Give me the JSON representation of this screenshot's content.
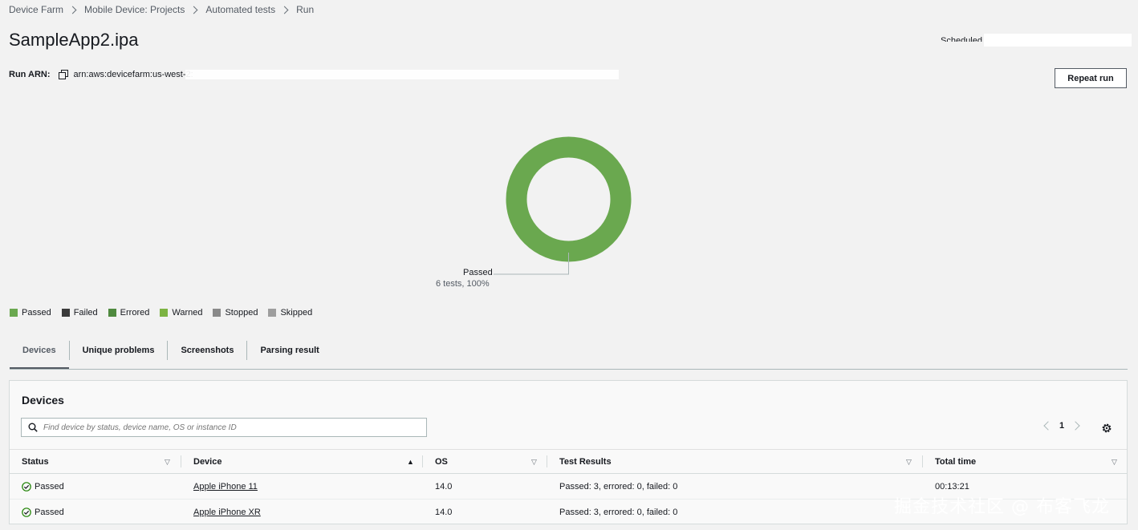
{
  "breadcrumb": [
    "Device Farm",
    "Mobile Device: Projects",
    "Automated tests",
    "Run"
  ],
  "title": "SampleApp2.ipa",
  "status_label": "Scheduled",
  "run_arn": {
    "label": "Run ARN:",
    "value": "arn:aws:devicefarm:us-west-2:"
  },
  "actions": {
    "repeat_run": "Repeat run"
  },
  "donut": {
    "label": "Passed",
    "detail": "6 tests, 100%",
    "passed_fraction": 1.0,
    "color": "#6aa84f"
  },
  "legend": [
    {
      "name": "Passed",
      "color": "#6aa84f"
    },
    {
      "name": "Failed",
      "color": "#3b3b3b"
    },
    {
      "name": "Errored",
      "color": "#4f8a3f"
    },
    {
      "name": "Warned",
      "color": "#7cb342"
    },
    {
      "name": "Stopped",
      "color": "#8a8a8a"
    },
    {
      "name": "Skipped",
      "color": "#9e9e9e"
    }
  ],
  "tabs": [
    "Devices",
    "Unique problems",
    "Screenshots",
    "Parsing result"
  ],
  "active_tab": "Devices",
  "panel": {
    "title": "Devices",
    "search_placeholder": "Find device by status, device name, OS or instance ID",
    "page": "1",
    "columns": [
      "Status",
      "Device",
      "OS",
      "Test Results",
      "Total time"
    ],
    "sorted_column": "Device",
    "rows": [
      {
        "status": "Passed",
        "device": "Apple iPhone 11",
        "os": "14.0",
        "results": "Passed: 3, errored: 0, failed: 0",
        "time": "00:13:21"
      },
      {
        "status": "Passed",
        "device": "Apple iPhone XR",
        "os": "14.0",
        "results": "Passed: 3, errored: 0, failed: 0",
        "time": ""
      }
    ]
  },
  "icons": {
    "copy": "copy-icon",
    "search": "search-icon",
    "settings": "gear-icon",
    "status_ok": "check-circle-icon"
  },
  "watermark": "掘金技术社区 @ 布客飞龙"
}
